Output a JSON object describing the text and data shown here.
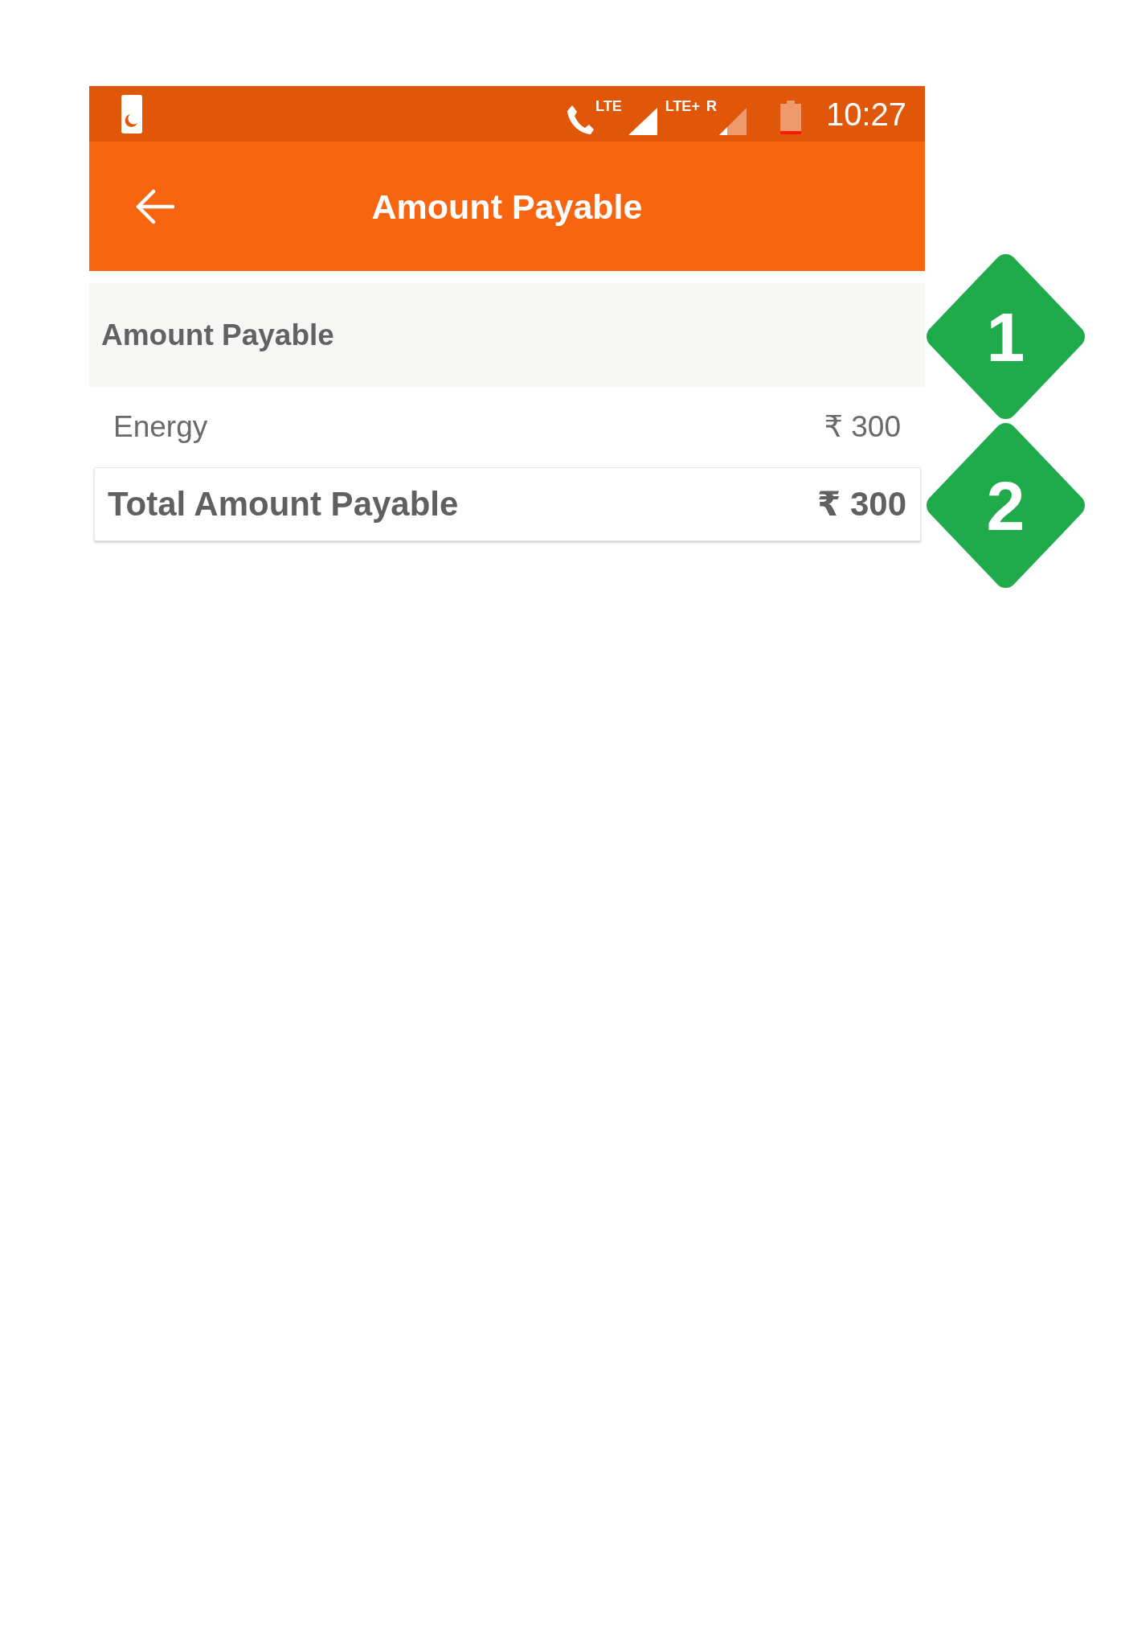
{
  "status_bar": {
    "call_label": "LTE",
    "network_label": "LTE+",
    "roaming_label": "R",
    "time": "10:27"
  },
  "app_bar": {
    "title": "Amount Payable"
  },
  "section": {
    "title": "Amount Payable"
  },
  "line_items": [
    {
      "label": "Energy",
      "amount": "₹ 300"
    }
  ],
  "total": {
    "label": "Total Amount Payable",
    "amount": "₹ 300"
  },
  "callouts": [
    {
      "label": "1"
    },
    {
      "label": "2"
    }
  ]
}
